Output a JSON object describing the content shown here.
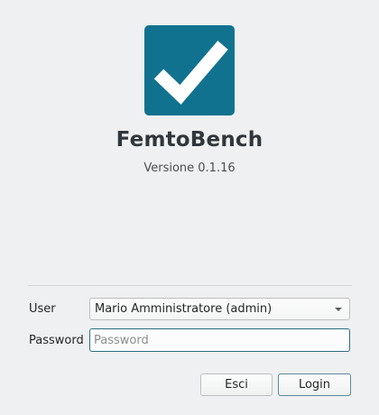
{
  "app": {
    "logo_icon": "checkmark-icon",
    "logo_color": "#11728f",
    "name": "FemtoBench",
    "version": "Versione 0.1.16"
  },
  "form": {
    "user_label": "User",
    "user_selected": "Mario Amministratore (admin)",
    "password_label": "Password",
    "password_placeholder": "Password",
    "password_value": ""
  },
  "buttons": {
    "cancel_label": "Esci",
    "login_label": "Login"
  }
}
